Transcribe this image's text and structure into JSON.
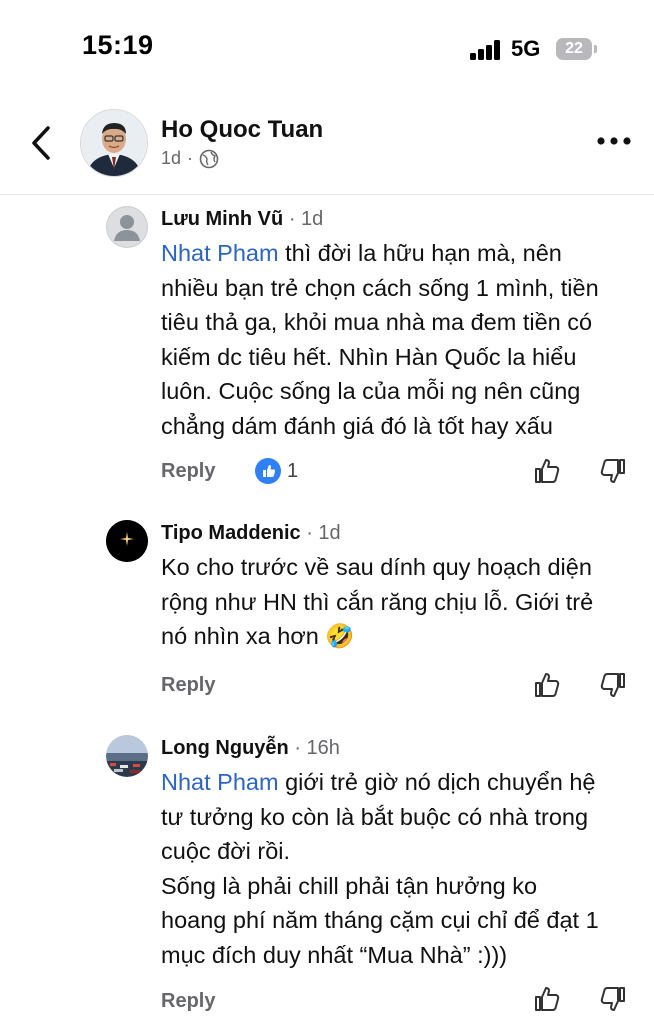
{
  "status_bar": {
    "time": "15:19",
    "network": "5G",
    "battery": "22"
  },
  "header": {
    "author_name": "Ho Quoc Tuan",
    "post_age": "1d",
    "separator": "·"
  },
  "comments": [
    {
      "author": "Lưu Minh Vũ",
      "age": "1d",
      "mention": "Nhat Pham",
      "lines": [
        "thì đời la hữu hạn mà, nên",
        "nhiều bạn trẻ chọn cách sống 1 mình, tiền",
        "tiêu thả ga, khỏi mua nhà ma đem tiền có",
        "kiếm dc tiêu hết. Nhìn Hàn Quốc la hiểu",
        "luôn. Cuộc sống la của mỗi ng nên cũng",
        "chẳng dám đánh giá đó là tốt hay xấu"
      ],
      "reply_label": "Reply",
      "like_count": "1"
    },
    {
      "author": "Tipo Maddenic",
      "age": "1d",
      "lines": [
        "Ko cho trước về sau dính quy hoạch diện",
        "rộng như HN thì cắn răng chịu lỗ. Giới trẻ",
        "nó nhìn xa hơn 🤣"
      ],
      "reply_label": "Reply"
    },
    {
      "author": "Long Nguyễn",
      "age": "16h",
      "mention": "Nhat Pham",
      "lines": [
        "giới trẻ giờ nó dịch chuyển hệ",
        "tư tưởng ko còn là bắt buộc có nhà trong",
        "cuộc đời rồi.",
        "Sống là phải chill phải tận hưởng ko",
        "hoang phí năm tháng cặm cụi chỉ để đạt 1",
        "mục đích duy nhất “Mua Nhà” :)))"
      ],
      "reply_label": "Reply"
    }
  ],
  "colors": {
    "mention": "#2c64c5",
    "secondary_text": "#65676b",
    "like_badge": "#2f7ff6"
  },
  "icons": [
    "back-arrow-icon",
    "globe-icon",
    "more-dots-icon",
    "thumbs-up-icon",
    "thumbs-down-icon",
    "like-reaction-icon",
    "default-avatar-icon"
  ]
}
